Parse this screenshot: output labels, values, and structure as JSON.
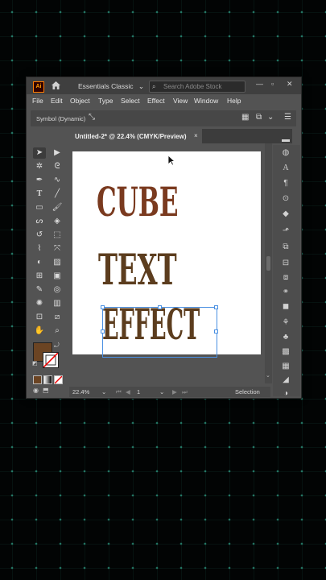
{
  "app": {
    "logo": "Ai",
    "workspace": "Essentials Classic",
    "search_placeholder": "Search Adobe Stock"
  },
  "menu": [
    "File",
    "Edit",
    "Object",
    "Type",
    "Select",
    "Effect",
    "View",
    "Window",
    "Help"
  ],
  "control_bar": {
    "label": "Symbol (Dynamic)"
  },
  "document_tab": {
    "title": "Untitled-2* @ 22.4% (CMYK/Preview)",
    "close": "×"
  },
  "artboard": {
    "lines": [
      {
        "text": "CUBE",
        "color": "#7a3a1f"
      },
      {
        "text": "TEXT",
        "color": "#5c3d1e"
      },
      {
        "text": "EFFECT",
        "color": "#5c3d1e"
      }
    ]
  },
  "colors": {
    "fill_swatch": "#6b4423",
    "accent": "#4a90e2",
    "text_brown_light": "#7a3a1f",
    "text_brown_dark": "#5c3d1e"
  },
  "status_bar": {
    "zoom": "22.4%",
    "artboard_number": "1",
    "tool": "Selection"
  },
  "icons": {
    "left_tools": [
      "selection-tool-icon",
      "direct-selection-tool-icon",
      "magic-wand-icon",
      "lasso-icon",
      "pen-icon",
      "curvature-icon",
      "type-icon",
      "line-segment-icon",
      "rectangle-icon",
      "paintbrush-icon",
      "shaper-icon",
      "eraser-icon",
      "rotate-icon",
      "scale-icon",
      "warp-icon",
      "free-transform-icon",
      "shape-builder-icon",
      "perspective-grid-icon",
      "mesh-icon",
      "gradient-icon",
      "eyedropper-icon",
      "blend-icon",
      "symbol-sprayer-icon",
      "column-graph-icon",
      "artboard-icon",
      "slice-icon",
      "hand-icon",
      "zoom-icon"
    ],
    "right_panel": [
      "color-panel-icon",
      "color-guide-icon",
      "character-icon",
      "paragraph-icon",
      "opentype-icon",
      "layers-icon",
      "export-icon",
      "transform-icon",
      "align-icon",
      "pathfinder-icon",
      "links-icon",
      "appearance-icon",
      "brushes-icon",
      "symbols-icon",
      "graphic-styles-icon",
      "swatches-icon",
      "stroke-icon",
      "transparency-icon",
      "gradient-panel-icon",
      "libraries-icon"
    ]
  }
}
